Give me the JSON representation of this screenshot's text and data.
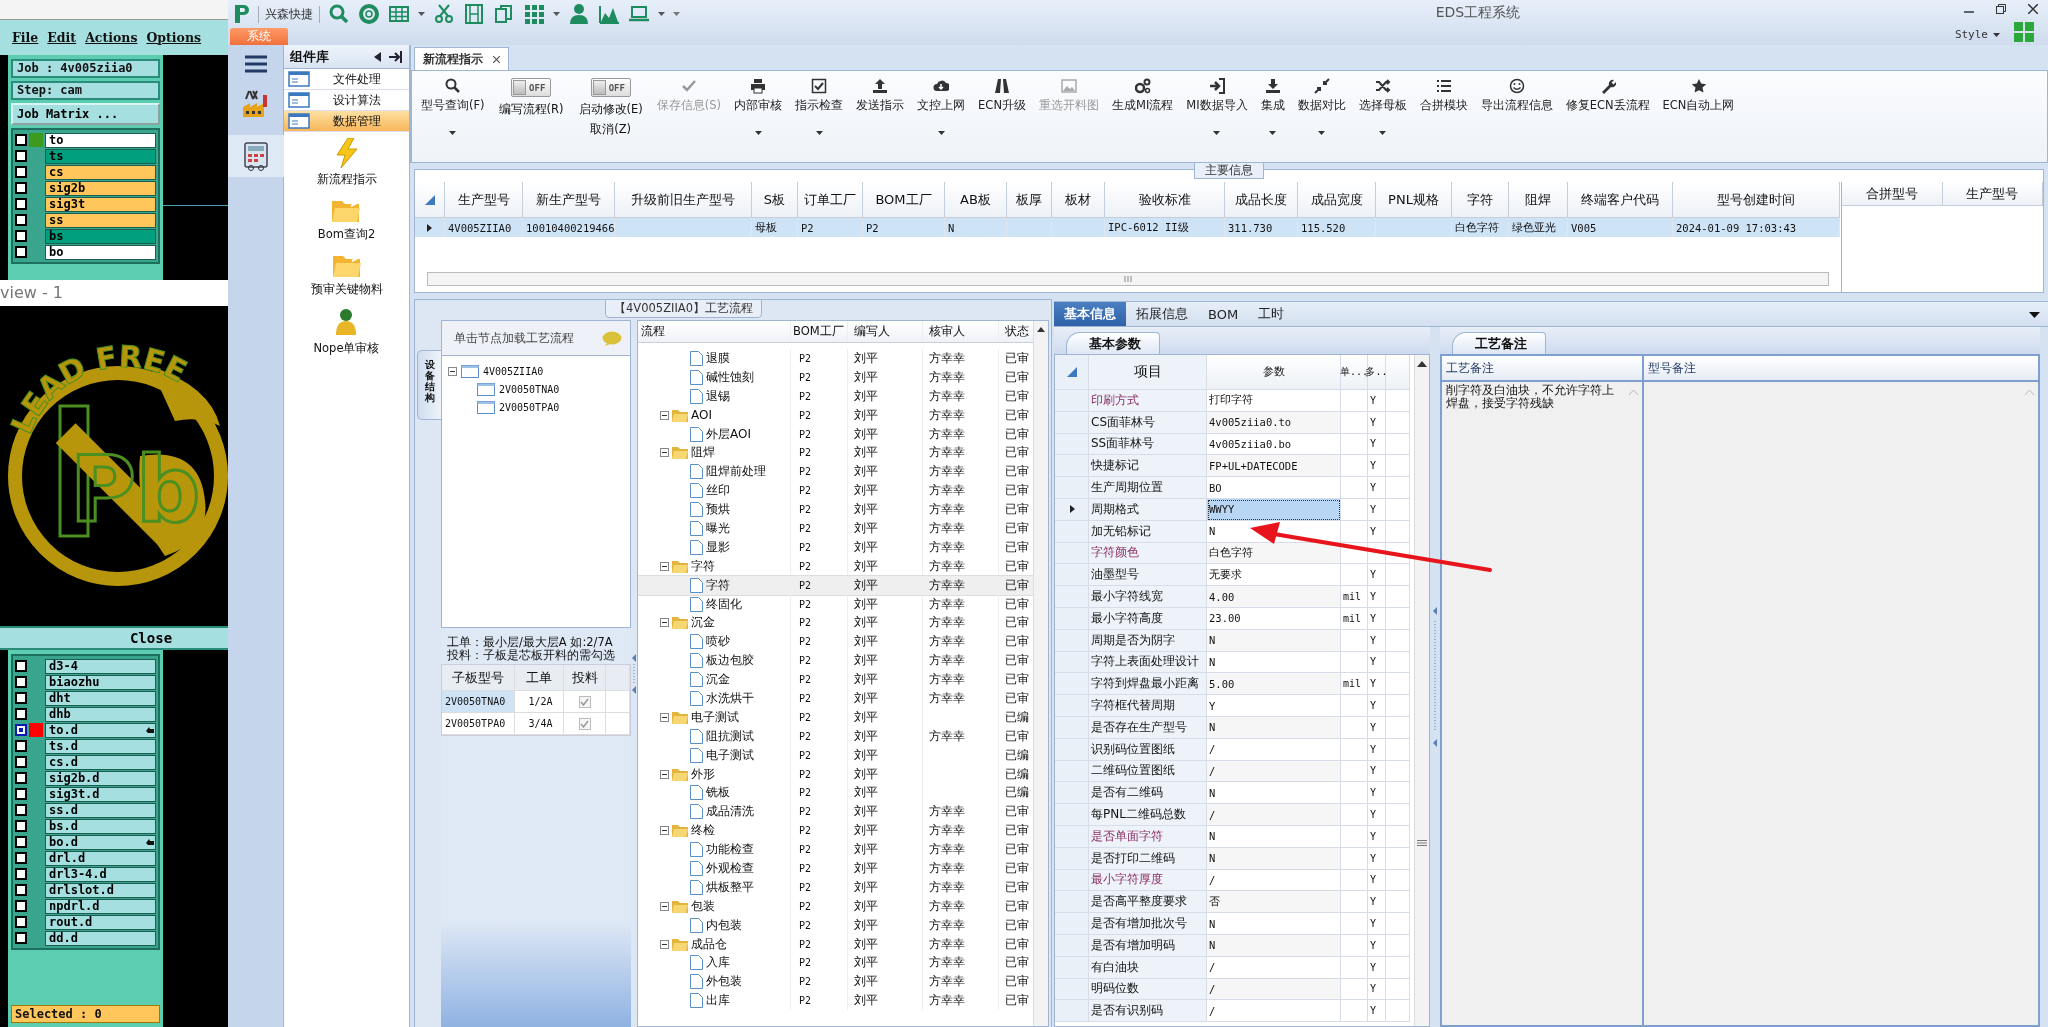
{
  "graphic_editor": {
    "menu": [
      "File",
      "Edit",
      "Actions",
      "Options"
    ],
    "job": "Job : 4v005ziia0",
    "step": "Step: cam",
    "job_matrix_button": "Job Matrix ...",
    "layers_top": [
      {
        "name": "to",
        "color": "#ffffff",
        "marker": {
          "color": "#3c9a1e"
        },
        "selected": false,
        "flagged": false
      },
      {
        "name": "ts",
        "color": "#009f7d",
        "selected": false,
        "flagged": false
      },
      {
        "name": "cs",
        "color": "#ffc65c",
        "selected": false,
        "flagged": false
      },
      {
        "name": "sig2b",
        "color": "#ffc65c",
        "selected": false,
        "flagged": false
      },
      {
        "name": "sig3t",
        "color": "#ffc65c",
        "selected": false,
        "flagged": false
      },
      {
        "name": "ss",
        "color": "#ffc65c",
        "selected": false,
        "flagged": false
      },
      {
        "name": "bs",
        "color": "#009f7d",
        "selected": false,
        "flagged": false
      },
      {
        "name": "bo",
        "color": "#ffffff",
        "selected": false,
        "flagged": false
      }
    ],
    "preview": {
      "title": "view - 1",
      "logo_text": "LEAD FREE",
      "symbol": "Pb"
    },
    "close_button": "Close",
    "layers_bottom": [
      {
        "name": "d3-4",
        "color": "#a6dfe0",
        "selected": false,
        "flagged": false
      },
      {
        "name": "biaozhu",
        "color": "#a6dfe0",
        "selected": false,
        "flagged": false
      },
      {
        "name": "dht",
        "color": "#a6dfe0",
        "selected": false,
        "flagged": false
      },
      {
        "name": "dhb",
        "color": "#a6dfe0",
        "selected": false,
        "flagged": false
      },
      {
        "name": "to.d",
        "color": "#a6dfe0",
        "marker": {
          "color": "#ff0000"
        },
        "selected": true,
        "flagged": true
      },
      {
        "name": "ts.d",
        "color": "#a6dfe0",
        "selected": false,
        "flagged": false
      },
      {
        "name": "cs.d",
        "color": "#a6dfe0",
        "selected": false,
        "flagged": false
      },
      {
        "name": "sig2b.d",
        "color": "#a6dfe0",
        "selected": false,
        "flagged": false
      },
      {
        "name": "sig3t.d",
        "color": "#a6dfe0",
        "selected": false,
        "flagged": false
      },
      {
        "name": "ss.d",
        "color": "#a6dfe0",
        "selected": false,
        "flagged": false
      },
      {
        "name": "bs.d",
        "color": "#a6dfe0",
        "selected": false,
        "flagged": false
      },
      {
        "name": "bo.d",
        "color": "#a6dfe0",
        "selected": false,
        "flagged": true
      },
      {
        "name": "drl.d",
        "color": "#a6dfe0",
        "selected": false,
        "flagged": false
      },
      {
        "name": "drl3-4.d",
        "color": "#a6dfe0",
        "selected": false,
        "flagged": false
      },
      {
        "name": "drlslot.d",
        "color": "#a6dfe0",
        "selected": false,
        "flagged": false
      },
      {
        "name": "npdrl.d",
        "color": "#a6dfe0",
        "selected": false,
        "flagged": false
      },
      {
        "name": "rout.d",
        "color": "#a6dfe0",
        "selected": false,
        "flagged": false
      },
      {
        "name": "dd.d",
        "color": "#a6dfe0",
        "selected": false,
        "flagged": false
      }
    ],
    "status": "Selected : 0"
  },
  "app": {
    "brand": "兴森快捷",
    "title": "EDS工程系统",
    "system_tab": "系统",
    "style_menu": "Style"
  },
  "component_library": {
    "title": "组件库",
    "categories": [
      {
        "label": "文件处理",
        "selected": false
      },
      {
        "label": "设计算法",
        "selected": false
      },
      {
        "label": "数据管理",
        "selected": true
      }
    ],
    "modules": [
      {
        "label": "新流程指示",
        "kind": "lightning"
      },
      {
        "label": "Bom查询2",
        "kind": "folder"
      },
      {
        "label": "预审关键物料",
        "kind": "folder"
      },
      {
        "label": "Nope单审核",
        "kind": "user"
      }
    ]
  },
  "tabs": [
    {
      "label": "新流程指示",
      "selected": true
    }
  ],
  "toolbar": [
    {
      "kind": "button",
      "label": "型号查询(F)",
      "dropdown": true,
      "disabled": false
    },
    {
      "kind": "toggle",
      "label": "编写流程(R)",
      "switch_text": "OFF",
      "on": false
    },
    {
      "kind": "toggle",
      "label": "启动修改(E)",
      "sublabel": "取消(Z)",
      "switch_text": "OFF",
      "on": false
    },
    {
      "kind": "button",
      "label": "保存信息(S)",
      "dropdown": false,
      "disabled": true
    },
    {
      "kind": "button",
      "label": "内部审核",
      "dropdown": true,
      "disabled": false
    },
    {
      "kind": "button",
      "label": "指示检查",
      "dropdown": true,
      "disabled": false
    },
    {
      "kind": "button",
      "label": "发送指示",
      "dropdown": false,
      "disabled": false
    },
    {
      "kind": "button",
      "label": "文控上网",
      "dropdown": true,
      "disabled": false
    },
    {
      "kind": "button",
      "label": "ECN升级",
      "dropdown": false,
      "disabled": false
    },
    {
      "kind": "button",
      "label": "重选开料图",
      "dropdown": false,
      "disabled": true
    },
    {
      "kind": "button",
      "label": "生成MI流程",
      "dropdown": false,
      "disabled": false
    },
    {
      "kind": "button",
      "label": "MI数据导入",
      "dropdown": true,
      "disabled": false
    },
    {
      "kind": "button",
      "label": "集成",
      "dropdown": true,
      "disabled": false
    },
    {
      "kind": "button",
      "label": "数据对比",
      "dropdown": true,
      "disabled": false
    },
    {
      "kind": "button",
      "label": "选择母板",
      "dropdown": true,
      "disabled": false
    },
    {
      "kind": "button",
      "label": "合拼模块",
      "dropdown": false,
      "disabled": false
    },
    {
      "kind": "button",
      "label": "导出流程信息",
      "dropdown": false,
      "disabled": false
    },
    {
      "kind": "button",
      "label": "修复ECN丢流程",
      "dropdown": false,
      "disabled": false
    },
    {
      "kind": "button",
      "label": "ECN自动上网",
      "dropdown": false,
      "disabled": false
    }
  ],
  "main_info": {
    "title": "主要信息",
    "columns": [
      "生产型号",
      "新生产型号",
      "升级前旧生产型号",
      "S板",
      "订单工厂",
      "BOM工厂",
      "AB板",
      "板厚",
      "板材",
      "验收标准",
      "成品长度",
      "成品宽度",
      "PNL规格",
      "字符",
      "阻焊",
      "终端客户代码",
      "型号创建时间"
    ],
    "rows": [
      {
        "cells": [
          "4V005ZIIA0",
          "10010400219466",
          null,
          "母板",
          "P2",
          "P2",
          "N",
          null,
          null,
          "IPC-6012 II级",
          "311.730",
          "115.520",
          null,
          "白色字符",
          "绿色亚光",
          "V005",
          "2024-01-09 17:03:43"
        ],
        "selected": true
      }
    ],
    "merge_columns": [
      "合拼型号",
      "生产型号"
    ]
  },
  "process": {
    "title": "【4V005ZIIA0】工艺流程",
    "side_tab": "设备结构",
    "tree_header": "单击节点加载工艺流程",
    "tree": [
      {
        "label": "4V005ZIIA0",
        "expanded": true,
        "children": [
          {
            "label": "2V0050TNA0"
          },
          {
            "label": "2V0050TPA0"
          }
        ]
      }
    ],
    "notes": [
      "工单：最小层/最大层A 如:2/7A",
      "投料：子板是芯板开料的需勾选"
    ],
    "sub_boards": {
      "columns": [
        "子板型号",
        "工单",
        "投料"
      ],
      "rows": [
        {
          "model": "2V0050TNA0",
          "order": "1/2A",
          "checked": true,
          "selected": true
        },
        {
          "model": "2V0050TPA0",
          "order": "3/4A",
          "checked": true,
          "selected": false
        }
      ]
    },
    "flow": {
      "columns": [
        "流程",
        "BOM工厂",
        "编写人",
        "核审人",
        "状态"
      ],
      "rows": [
        {
          "kind": "step",
          "label": "退膜",
          "bom": "P2",
          "writer": "刘平",
          "reviewer": "方幸幸",
          "status": "已审",
          "selected": false
        },
        {
          "kind": "step",
          "label": "碱性蚀刻",
          "bom": "P2",
          "writer": "刘平",
          "reviewer": "方幸幸",
          "status": "已审",
          "selected": false
        },
        {
          "kind": "step",
          "label": "退锡",
          "bom": "P2",
          "writer": "刘平",
          "reviewer": "方幸幸",
          "status": "已审",
          "selected": false
        },
        {
          "kind": "folder",
          "label": "AOI",
          "bom": "P2",
          "writer": "刘平",
          "reviewer": "方幸幸",
          "status": "已审",
          "selected": false,
          "expanded": true,
          "children": [
            {
              "kind": "step",
              "label": "外层AOI",
              "bom": "P2",
              "writer": "刘平",
              "reviewer": "方幸幸",
              "status": "已审",
              "selected": false
            }
          ]
        },
        {
          "kind": "folder",
          "label": "阻焊",
          "bom": "P2",
          "writer": "刘平",
          "reviewer": "方幸幸",
          "status": "已审",
          "selected": false,
          "expanded": true,
          "children": [
            {
              "kind": "step",
              "label": "阻焊前处理",
              "bom": "P2",
              "writer": "刘平",
              "reviewer": "方幸幸",
              "status": "已审",
              "selected": false
            },
            {
              "kind": "step",
              "label": "丝印",
              "bom": "P2",
              "writer": "刘平",
              "reviewer": "方幸幸",
              "status": "已审",
              "selected": false
            },
            {
              "kind": "step",
              "label": "预烘",
              "bom": "P2",
              "writer": "刘平",
              "reviewer": "方幸幸",
              "status": "已审",
              "selected": false
            },
            {
              "kind": "step",
              "label": "曝光",
              "bom": "P2",
              "writer": "刘平",
              "reviewer": "方幸幸",
              "status": "已审",
              "selected": false
            },
            {
              "kind": "step",
              "label": "显影",
              "bom": "P2",
              "writer": "刘平",
              "reviewer": "方幸幸",
              "status": "已审",
              "selected": false
            }
          ]
        },
        {
          "kind": "folder",
          "label": "字符",
          "bom": "P2",
          "writer": "刘平",
          "reviewer": "方幸幸",
          "status": "已审",
          "selected": false,
          "expanded": true,
          "children": [
            {
              "kind": "step",
              "label": "字符",
              "bom": "P2",
              "writer": "刘平",
              "reviewer": "方幸幸",
              "status": "已审",
              "selected": true
            },
            {
              "kind": "step",
              "label": "终固化",
              "bom": "P2",
              "writer": "刘平",
              "reviewer": "方幸幸",
              "status": "已审",
              "selected": false
            }
          ]
        },
        {
          "kind": "folder",
          "label": "沉金",
          "bom": "P2",
          "writer": "刘平",
          "reviewer": "方幸幸",
          "status": "已审",
          "selected": false,
          "expanded": true,
          "children": [
            {
              "kind": "step",
              "label": "喷砂",
              "bom": "P2",
              "writer": "刘平",
              "reviewer": "方幸幸",
              "status": "已审",
              "selected": false
            },
            {
              "kind": "step",
              "label": "板边包胶",
              "bom": "P2",
              "writer": "刘平",
              "reviewer": "方幸幸",
              "status": "已审",
              "selected": false
            },
            {
              "kind": "step",
              "label": "沉金",
              "bom": "P2",
              "writer": "刘平",
              "reviewer": "方幸幸",
              "status": "已审",
              "selected": false
            },
            {
              "kind": "step",
              "label": "水洗烘干",
              "bom": "P2",
              "writer": "刘平",
              "reviewer": "方幸幸",
              "status": "已审",
              "selected": false
            }
          ]
        },
        {
          "kind": "folder",
          "label": "电子测试",
          "bom": "P2",
          "writer": "刘平",
          "status": "已编",
          "selected": false,
          "expanded": true,
          "children": [
            {
              "kind": "step",
              "label": "阻抗测试",
              "bom": "P2",
              "writer": "刘平",
              "reviewer": "方幸幸",
              "status": "已审",
              "selected": false
            },
            {
              "kind": "step",
              "label": "电子测试",
              "bom": "P2",
              "writer": "刘平",
              "status": "已编",
              "selected": false
            }
          ]
        },
        {
          "kind": "folder",
          "label": "外形",
          "bom": "P2",
          "writer": "刘平",
          "status": "已编",
          "selected": false,
          "expanded": true,
          "children": [
            {
              "kind": "step",
              "label": "铣板",
              "bom": "P2",
              "writer": "刘平",
              "status": "已编",
              "selected": false
            },
            {
              "kind": "step",
              "label": "成品清洗",
              "bom": "P2",
              "writer": "刘平",
              "reviewer": "方幸幸",
              "status": "已审",
              "selected": false
            }
          ]
        },
        {
          "kind": "folder",
          "label": "终检",
          "bom": "P2",
          "writer": "刘平",
          "reviewer": "方幸幸",
          "status": "已审",
          "selected": false,
          "expanded": true,
          "children": [
            {
              "kind": "step",
              "label": "功能检查",
              "bom": "P2",
              "writer": "刘平",
              "reviewer": "方幸幸",
              "status": "已审",
              "selected": false
            },
            {
              "kind": "step",
              "label": "外观检查",
              "bom": "P2",
              "writer": "刘平",
              "reviewer": "方幸幸",
              "status": "已审",
              "selected": false
            },
            {
              "kind": "step",
              "label": "烘板整平",
              "bom": "P2",
              "writer": "刘平",
              "reviewer": "方幸幸",
              "status": "已审",
              "selected": false
            }
          ]
        },
        {
          "kind": "folder",
          "label": "包装",
          "bom": "P2",
          "writer": "刘平",
          "reviewer": "方幸幸",
          "status": "已审",
          "selected": false,
          "expanded": true,
          "children": [
            {
              "kind": "step",
              "label": "内包装",
              "bom": "P2",
              "writer": "刘平",
              "reviewer": "方幸幸",
              "status": "已审",
              "selected": false
            }
          ]
        },
        {
          "kind": "folder",
          "label": "成品仓",
          "bom": "P2",
          "writer": "刘平",
          "reviewer": "方幸幸",
          "status": "已审",
          "selected": false,
          "expanded": true,
          "children": [
            {
              "kind": "step",
              "label": "入库",
              "bom": "P2",
              "writer": "刘平",
              "reviewer": "方幸幸",
              "status": "已审",
              "selected": false
            },
            {
              "kind": "step",
              "label": "外包装",
              "bom": "P2",
              "writer": "刘平",
              "reviewer": "方幸幸",
              "status": "已审",
              "selected": false
            },
            {
              "kind": "step",
              "label": "出库",
              "bom": "P2",
              "writer": "刘平",
              "reviewer": "方幸幸",
              "status": "已审",
              "selected": false
            }
          ]
        }
      ]
    }
  },
  "details": {
    "tabs": [
      {
        "label": "基本信息",
        "selected": true
      },
      {
        "label": "拓展信息",
        "selected": false
      },
      {
        "label": "BOM",
        "selected": false
      },
      {
        "label": "工时",
        "selected": false
      }
    ],
    "params": {
      "tab": "基本参数",
      "columns": [
        "项目",
        "参数",
        "单...",
        "多.."
      ],
      "rows": [
        {
          "item": "印刷方式",
          "value": "打印字符",
          "flag": "Y",
          "emphasized": true,
          "selected": false
        },
        {
          "item": "CS面菲林号",
          "value": "4v005ziia0.to",
          "flag": "Y",
          "emphasized": false,
          "selected": false
        },
        {
          "item": "SS面菲林号",
          "value": "4v005ziia0.bo",
          "flag": "Y",
          "emphasized": false,
          "selected": false
        },
        {
          "item": "快捷标记",
          "value": "FP+UL+DATECODE",
          "flag": "Y",
          "emphasized": false,
          "selected": false
        },
        {
          "item": "生产周期位置",
          "value": "BO",
          "flag": "Y",
          "emphasized": false,
          "selected": false
        },
        {
          "item": "周期格式",
          "value": "WWYY",
          "flag": "Y",
          "emphasized": false,
          "selected": true
        },
        {
          "item": "加无铅标记",
          "value": "N",
          "flag": "Y",
          "emphasized": false,
          "selected": false
        },
        {
          "item": "字符颜色",
          "value": "白色字符",
          "emphasized": true,
          "selected": false
        },
        {
          "item": "油墨型号",
          "value": "无要求",
          "flag": "Y",
          "emphasized": false,
          "selected": false
        },
        {
          "item": "最小字符线宽",
          "value": "4.00",
          "unit": "mil",
          "flag": "Y",
          "emphasized": false,
          "selected": false
        },
        {
          "item": "最小字符高度",
          "value": "23.00",
          "unit": "mil",
          "flag": "Y",
          "emphasized": false,
          "selected": false
        },
        {
          "item": "周期是否为阴字",
          "value": "N",
          "flag": "Y",
          "emphasized": false,
          "selected": false
        },
        {
          "item": "字符上表面处理设计",
          "value": "N",
          "flag": "Y",
          "emphasized": false,
          "selected": false
        },
        {
          "item": "字符到焊盘最小距离",
          "value": "5.00",
          "unit": "mil",
          "flag": "Y",
          "emphasized": false,
          "selected": false
        },
        {
          "item": "字符框代替周期",
          "value": "Y",
          "flag": "Y",
          "emphasized": false,
          "selected": false
        },
        {
          "item": "是否存在生产型号",
          "value": "N",
          "flag": "Y",
          "emphasized": false,
          "selected": false
        },
        {
          "item": "识别码位置图纸",
          "value": "/",
          "flag": "Y",
          "emphasized": false,
          "selected": false
        },
        {
          "item": "二维码位置图纸",
          "value": "/",
          "flag": "Y",
          "emphasized": false,
          "selected": false
        },
        {
          "item": "是否有二维码",
          "value": "N",
          "flag": "Y",
          "emphasized": false,
          "selected": false
        },
        {
          "item": "每PNL二维码总数",
          "value": "/",
          "flag": "Y",
          "emphasized": false,
          "selected": false
        },
        {
          "item": "是否单面字符",
          "value": "N",
          "flag": "Y",
          "emphasized": true,
          "selected": false
        },
        {
          "item": "是否打印二维码",
          "value": "N",
          "flag": "Y",
          "emphasized": false,
          "selected": false
        },
        {
          "item": "最小字符厚度",
          "value": "/",
          "flag": "Y",
          "emphasized": true,
          "selected": false
        },
        {
          "item": "是否高平整度要求",
          "value": "否",
          "flag": "Y",
          "emphasized": false,
          "selected": false
        },
        {
          "item": "是否有增加批次号",
          "value": "N",
          "flag": "Y",
          "emphasized": false,
          "selected": false
        },
        {
          "item": "是否有增加明码",
          "value": "N",
          "flag": "Y",
          "emphasized": false,
          "selected": false
        },
        {
          "item": "有白油块",
          "value": "/",
          "flag": "Y",
          "emphasized": false,
          "selected": false
        },
        {
          "item": "明码位数",
          "value": "/",
          "flag": "Y",
          "emphasized": false,
          "selected": false
        },
        {
          "item": "是否有识别码",
          "value": "/",
          "flag": "Y",
          "emphasized": false,
          "selected": false
        }
      ]
    },
    "notes": {
      "tab": "工艺备注",
      "columns": [
        "工艺备注",
        "型号备注"
      ],
      "process_note": "削字符及白油块，不允许字符上焊盘，接受字符残缺"
    }
  }
}
